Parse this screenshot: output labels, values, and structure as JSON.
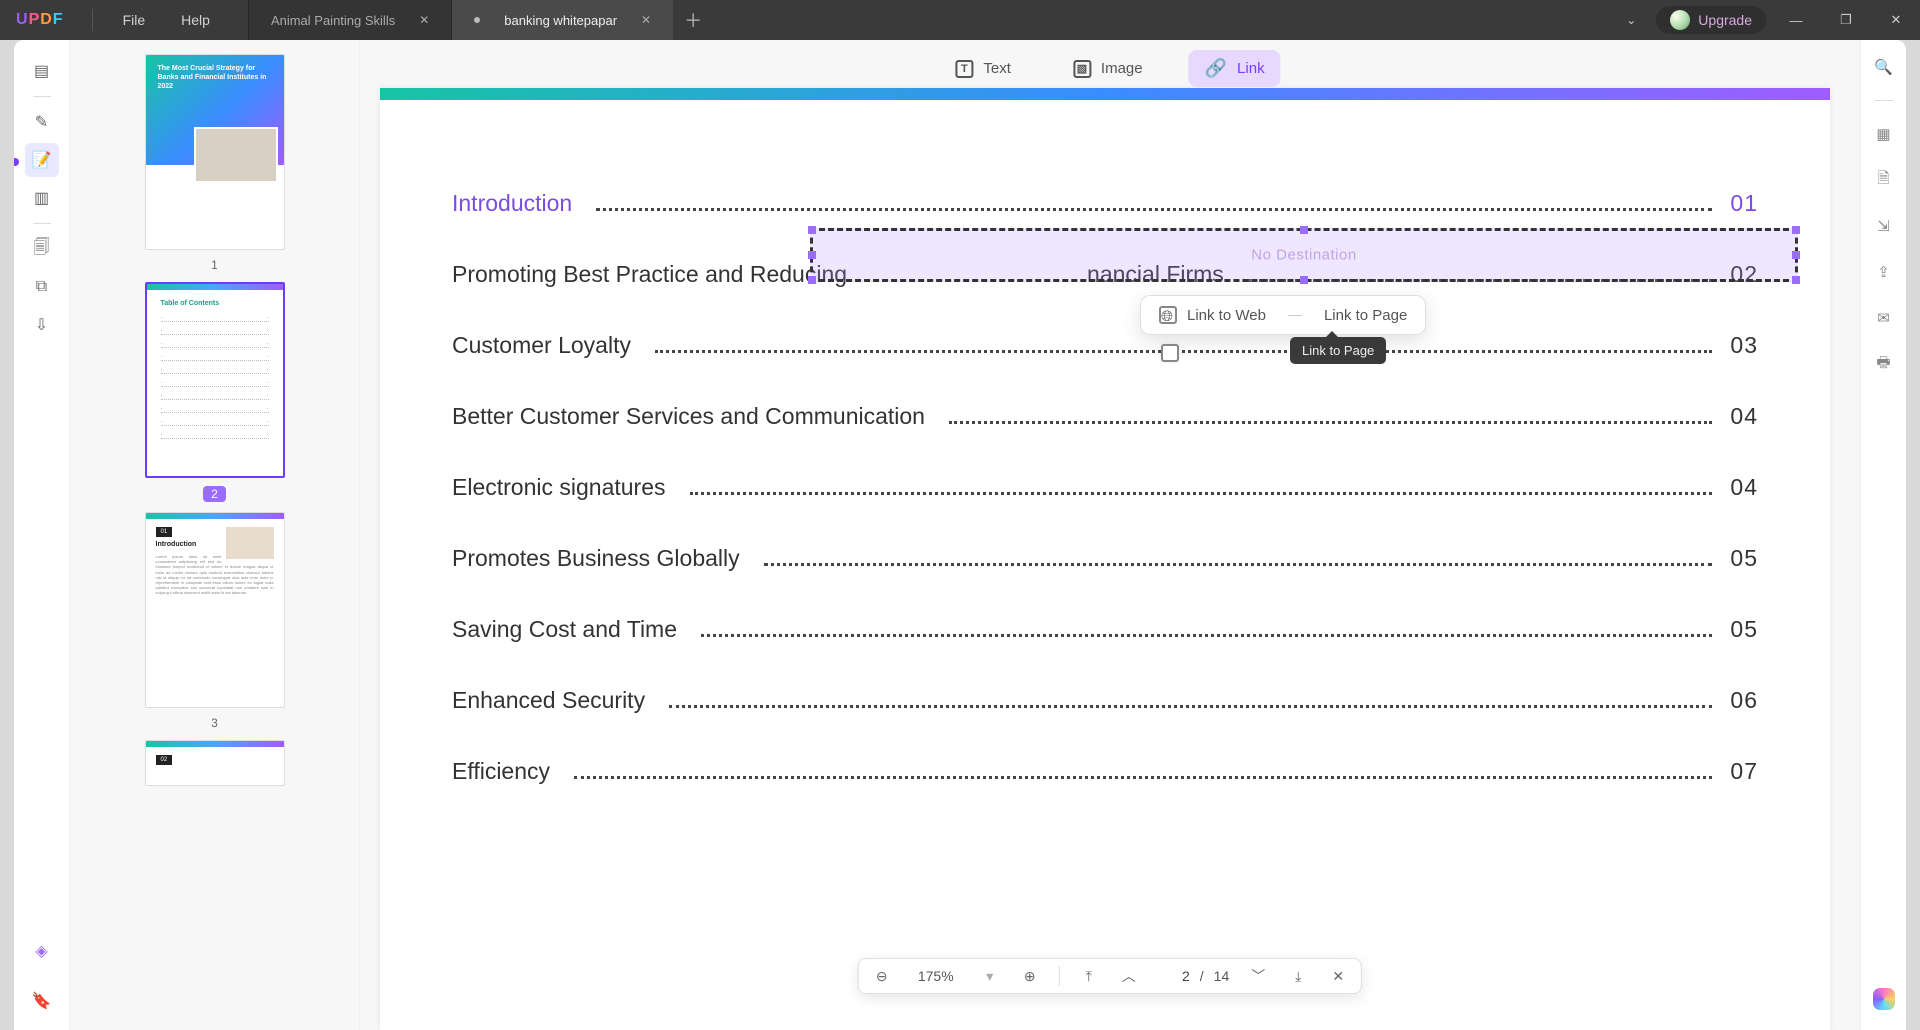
{
  "menus": {
    "file": "File",
    "help": "Help"
  },
  "tabs": [
    {
      "title": "Animal Painting Skills",
      "active": false,
      "unsaved": false
    },
    {
      "title": "banking whitepapar",
      "active": true,
      "unsaved": true
    }
  ],
  "upgrade_label": "Upgrade",
  "edit_toolbar": {
    "text": "Text",
    "image": "Image",
    "link": "Link"
  },
  "link_popup": {
    "web": "Link to Web",
    "page": "Link to Page",
    "tooltip": "Link to Page",
    "selection_placeholder": "No Destination"
  },
  "thumbnails": {
    "p1_title": "The Most Crucial Strategy for Banks and Financial Institutes in 2022",
    "p2_heading": "Table of Contents",
    "labels": [
      "1",
      "2",
      "3"
    ],
    "p3_badge": "01",
    "p3_title": "Introduction"
  },
  "toc": [
    {
      "title": "Introduction",
      "page": "01",
      "linked": true
    },
    {
      "title": "Promoting Best Practice and Reducing",
      "page": "02",
      "tail": "nancial Firms"
    },
    {
      "title": "Customer Loyalty",
      "page": "03"
    },
    {
      "title": "Better Customer Services and Communication",
      "page": "04"
    },
    {
      "title": "Electronic signatures",
      "page": "04"
    },
    {
      "title": "Promotes Business Globally",
      "page": "05"
    },
    {
      "title": "Saving Cost and Time",
      "page": "05"
    },
    {
      "title": "Enhanced Security",
      "page": "06"
    },
    {
      "title": "Efficiency",
      "page": "07"
    }
  ],
  "page_nav": {
    "zoom": "175%",
    "current": "2",
    "sep": "/",
    "total": "14"
  }
}
